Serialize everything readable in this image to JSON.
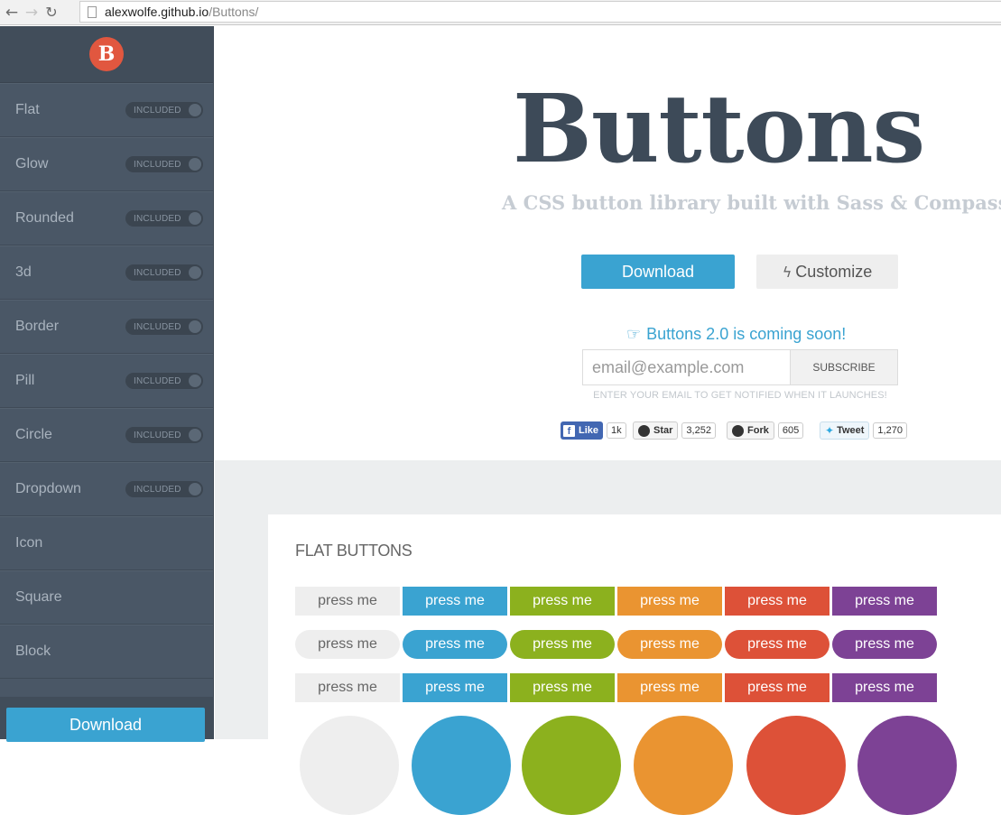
{
  "browser": {
    "url_host": "alexwolfe.github.io",
    "url_path": "/Buttons/"
  },
  "sidebar": {
    "logo_letter": "B",
    "items": [
      {
        "label": "Flat",
        "badge": "INCLUDED"
      },
      {
        "label": "Glow",
        "badge": "INCLUDED"
      },
      {
        "label": "Rounded",
        "badge": "INCLUDED"
      },
      {
        "label": "3d",
        "badge": "INCLUDED"
      },
      {
        "label": "Border",
        "badge": "INCLUDED"
      },
      {
        "label": "Pill",
        "badge": "INCLUDED"
      },
      {
        "label": "Circle",
        "badge": "INCLUDED"
      },
      {
        "label": "Dropdown",
        "badge": "INCLUDED"
      },
      {
        "label": "Icon"
      },
      {
        "label": "Square"
      },
      {
        "label": "Block"
      }
    ],
    "download_label": "Download"
  },
  "hero": {
    "title": "Buttons",
    "subtitle": "A CSS button library built with Sass & Compass",
    "download_label": "Download",
    "customize_label": "Customize",
    "customize_icon": "bolt-icon",
    "coming_soon": "Buttons 2.0 is coming soon!",
    "coming_soon_icon": "thumbs-up-icon",
    "email_placeholder": "email@example.com",
    "subscribe_label": "SUBSCRIBE",
    "notify_note": "ENTER YOUR EMAIL TO GET NOTIFIED WHEN IT LAUNCHES!"
  },
  "social": {
    "like_label": "Like",
    "like_count": "1k",
    "star_label": "Star",
    "star_count": "3,252",
    "fork_label": "Fork",
    "fork_count": "605",
    "tweet_label": "Tweet",
    "tweet_count": "1,270"
  },
  "flat_section": {
    "title": "FLAT BUTTONS",
    "button_label": "press me",
    "colors": {
      "gray": "#eeeeee",
      "blue": "#3aa3d1",
      "green": "#8cb11e",
      "orange": "#ea9431",
      "red": "#dd5138",
      "purple": "#7d4295"
    }
  },
  "colors": {
    "accent": "#3aa3d1",
    "sidebar_bg": "#4a5766",
    "title": "#3d4a58",
    "logo": "#e1573f"
  }
}
